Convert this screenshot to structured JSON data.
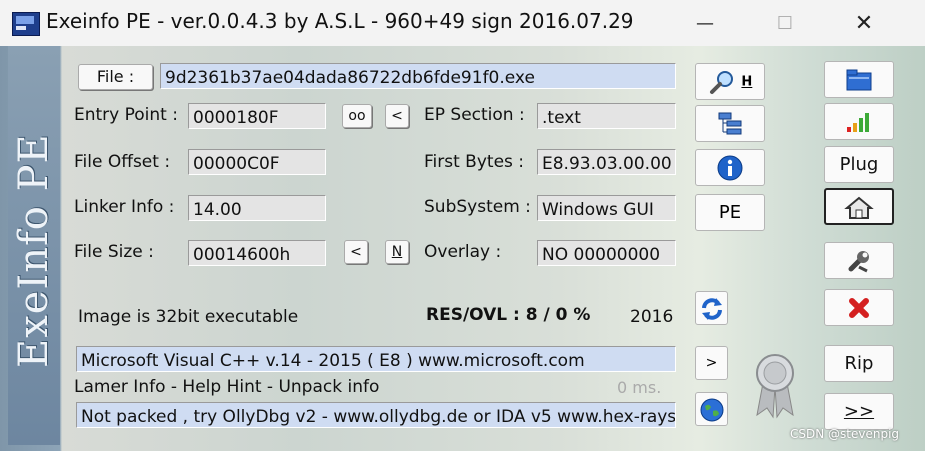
{
  "window": {
    "title": "Exeinfo PE - ver.0.0.4.3  by A.S.L -  960+49 sign  2016.07.29",
    "sidebar_text": "ExeInfo PE"
  },
  "file": {
    "button_label": "File :",
    "value": "9d2361b37ae04dada86722db6fde91f0.exe"
  },
  "fields": {
    "entry_point": {
      "label": "Entry Point :",
      "value": "0000180F"
    },
    "ep_section": {
      "label": "EP Section :",
      "value": ".text"
    },
    "file_offset": {
      "label": "File Offset :",
      "value": "00000C0F"
    },
    "first_bytes": {
      "label": "First Bytes :",
      "value": "E8.93.03.00.00"
    },
    "linker_info": {
      "label": "Linker Info :",
      "value": "14.00"
    },
    "subsystem": {
      "label": "SubSystem :",
      "value": "Windows GUI"
    },
    "file_size": {
      "label": "File Size :",
      "value": "00014600h"
    },
    "overlay": {
      "label": "Overlay :",
      "value": "NO   00000000"
    }
  },
  "buttons": {
    "oo": "oo",
    "lt1": "<",
    "lt2": "<",
    "n": "N",
    "h": "H",
    "pe": "PE",
    "gt": ">",
    "plug": "Plug",
    "rip": "Rip",
    "next": ">>"
  },
  "info": {
    "image_text": "Image is 32bit executable",
    "res_ovl": "RES/OVL : 8 / 0 %",
    "year": "2016",
    "compiler": "Microsoft Visual C++ v.14 - 2015 ( E8 ) www.microsoft.com",
    "lamer": "Lamer Info - Help Hint - Unpack info",
    "time": "0 ms.",
    "hint": "Not packed , try OllyDbg v2 - www.ollydbg.de or IDA v5 www.hex-rays"
  },
  "watermark": "CSDN @stevenpig",
  "colors": {
    "field_blue": "#cfdcf2",
    "close_red": "#d42020"
  }
}
